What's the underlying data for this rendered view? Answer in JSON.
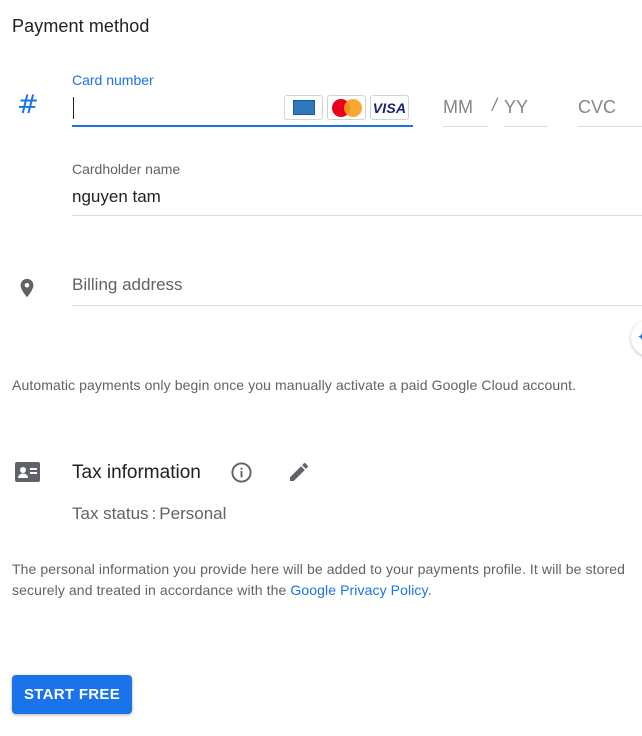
{
  "section_title": "Payment method",
  "card": {
    "label": "Card number",
    "value": "",
    "brands": [
      "amex-icon",
      "mastercard-icon",
      "visa-icon"
    ],
    "visa_text": "VISA",
    "month_placeholder": "MM",
    "separator": "/",
    "year_placeholder": "YY",
    "cvc_placeholder": "CVC"
  },
  "cardholder": {
    "label": "Cardholder name",
    "value": "nguyen tam"
  },
  "billing": {
    "placeholder": "Billing address"
  },
  "auto_payments_note": "Automatic payments only begin once you manually activate a paid Google Cloud account.",
  "tax": {
    "title": "Tax information",
    "status_label": "Tax status",
    "status_separator": ":",
    "status_value": "Personal"
  },
  "privacy": {
    "text": "The personal information you provide here will be added to your payments profile. It will be stored securely and treated in accordance with the ",
    "link_text": "Google Privacy Policy",
    "suffix": "."
  },
  "start_button": "START FREE",
  "colors": {
    "accent": "#1a73e8",
    "text": "#202124",
    "secondary_text": "#5f6368",
    "border": "#dadce0"
  }
}
